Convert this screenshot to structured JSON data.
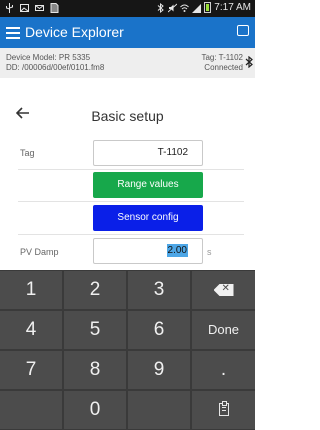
{
  "status_bar": {
    "time": "7:17 AM",
    "icons": [
      "usb-icon",
      "image-icon",
      "mail-icon",
      "sim-icon",
      "bluetooth-icon",
      "mute-icon",
      "wifi-icon",
      "signal-icon",
      "battery-icon"
    ]
  },
  "app_bar": {
    "title": "Device Explorer",
    "menu_icon": "menu-icon",
    "right_icon": "chat-icon"
  },
  "device_info": {
    "model": "Device Model:  PR 5335",
    "dd": "DD:  /00006d/00ef/0101.fm8",
    "tag": "Tag:  T-1102",
    "status": "Connected",
    "connection_icon": "bluetooth-icon"
  },
  "page": {
    "title": "Basic setup",
    "back_icon": "back-arrow-icon"
  },
  "form": {
    "tag_label": "Tag",
    "tag_value": "T-1102",
    "range_values_button": "Range values",
    "sensor_config_button": "Sensor config",
    "pv_damp_label": "PV Damp",
    "pv_damp_value": "2.00",
    "pv_damp_unit": "s"
  },
  "colors": {
    "app_bar": "#1a73c9",
    "range_button": "#17a84b",
    "sensor_button": "#0a1fe8",
    "selection": "#4da6e6"
  },
  "keyboard": {
    "keys": [
      "1",
      "2",
      "3",
      "backspace",
      "4",
      "5",
      "6",
      "Done",
      "7",
      "8",
      "9",
      ".",
      "",
      "0",
      "",
      "clipboard"
    ],
    "done_label": "Done",
    "dot_label": "."
  }
}
